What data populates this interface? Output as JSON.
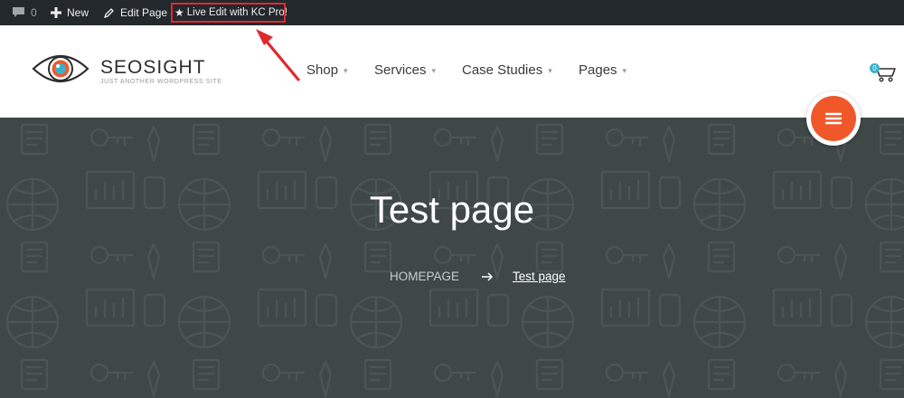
{
  "admin_bar": {
    "comments_count": "0",
    "new_label": "New",
    "edit_page_label": "Edit Page",
    "live_edit_label": "Live Edit with KC Pro!"
  },
  "header": {
    "site_title": "SEOSIGHT",
    "tagline": "JUST ANOTHER WORDPRESS SITE",
    "nav": [
      {
        "label": "Shop"
      },
      {
        "label": "Services"
      },
      {
        "label": "Case Studies"
      },
      {
        "label": "Pages"
      }
    ],
    "cart_count": "0"
  },
  "hero": {
    "title": "Test page",
    "breadcrumb": {
      "home": "HOMEPAGE",
      "current": "Test page"
    }
  },
  "colors": {
    "admin_bar_bg": "#23282d",
    "hero_bg": "#3f4847",
    "accent_orange": "#f0582a",
    "annotation_red": "#e0282e",
    "cart_badge": "#3cb0c9"
  },
  "icons": {
    "comments": "comment-bubble-icon",
    "new": "plus-icon",
    "edit": "pencil-icon",
    "live_edit": "star-icon",
    "cart": "shopping-cart-icon",
    "menu": "hamburger-icon",
    "breadcrumb_separator": "arrow-right-icon"
  }
}
